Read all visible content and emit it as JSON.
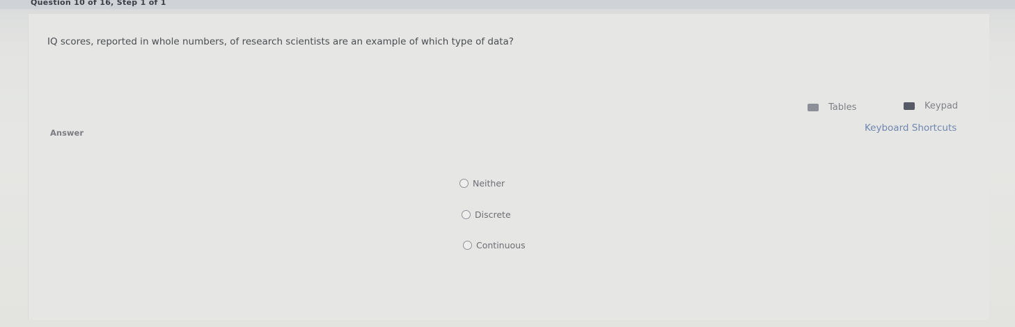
{
  "header": {
    "question_counter": "Question 10 of 16, Step 1 of 1"
  },
  "question": {
    "text": "IQ scores, reported in whole numbers, of research scientists are an example of which type of data?"
  },
  "tools": {
    "tables_label": "Tables",
    "keypad_label": "Keypad",
    "shortcuts_label": "Keyboard Shortcuts"
  },
  "answer": {
    "label": "Answer",
    "choices": [
      "Neither",
      "Discrete",
      "Continuous"
    ],
    "selected": null
  },
  "colors": {
    "background": "#e6e7e4",
    "link": "#6f86b0",
    "text": "#4a4c52"
  },
  "icons": {
    "tables": "tables-icon",
    "keypad": "keypad-icon",
    "radio": "radio-icon"
  }
}
